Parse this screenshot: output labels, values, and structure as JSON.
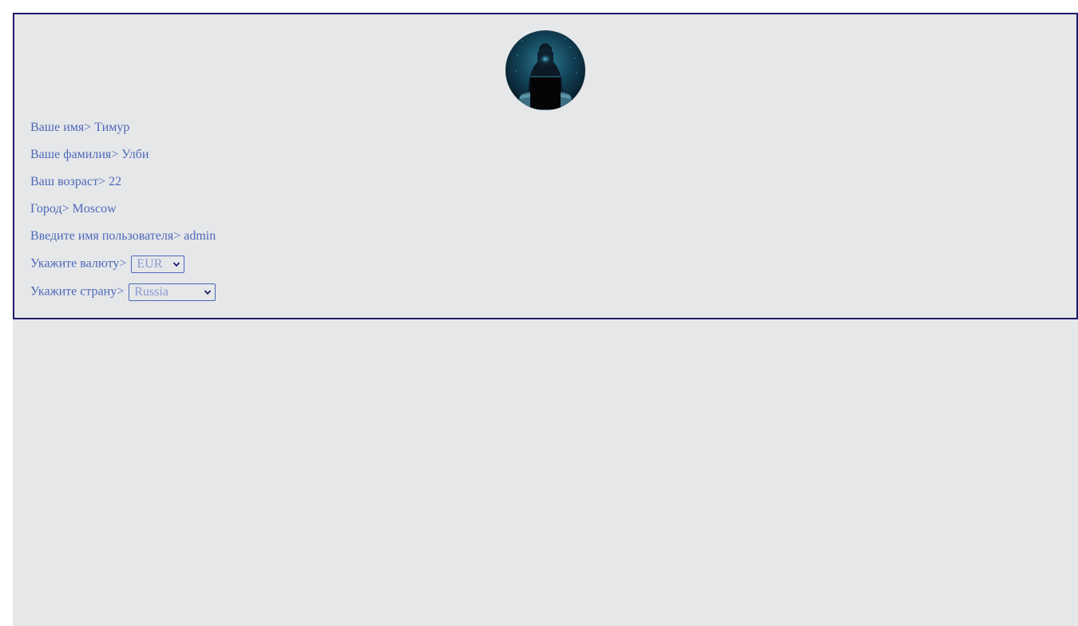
{
  "profile": {
    "avatar_icon": "hooded-hacker-avatar",
    "fields": [
      {
        "label": "Ваше имя>",
        "value": "Тимур"
      },
      {
        "label": "Ваше фамилия>",
        "value": "Улби"
      },
      {
        "label": "Ваш возраст>",
        "value": "22"
      },
      {
        "label": "Город>",
        "value": "Moscow"
      },
      {
        "label": "Введите имя пользователя>",
        "value": "admin"
      }
    ],
    "currency": {
      "label": "Укажите валюту>",
      "selected": "EUR"
    },
    "country": {
      "label": "Укажите страну>",
      "selected": "Russia"
    }
  },
  "colors": {
    "background": "#e6e7e9",
    "border": "#1e1b6b",
    "text": "#4d69b8"
  }
}
